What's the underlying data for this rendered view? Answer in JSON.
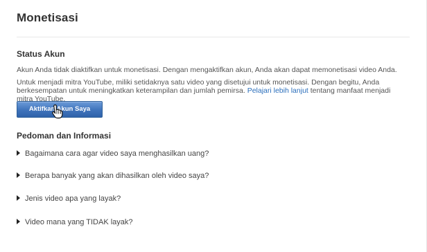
{
  "page": {
    "title": "Monetisasi"
  },
  "status": {
    "title": "Status Akun",
    "paragraph1": "Akun Anda tidak diaktifkan untuk monetisasi. Dengan mengaktifkan akun, Anda akan dapat memonetisasi video Anda.",
    "paragraph2_before": "Untuk menjadi mitra YouTube, miliki setidaknya satu video yang disetujui untuk monetisasi. Dengan begitu, Anda berkesempatan untuk meningkatkan keterampilan dan jumlah pemirsa. ",
    "paragraph2_link": "Pelajari lebih lanjut",
    "paragraph2_after": " tentang manfaat menjadi mitra YouTube.",
    "button_label": "Aktifkan Akun Saya"
  },
  "guide": {
    "title": "Pedoman dan Informasi",
    "items": [
      {
        "label": "Bagaimana cara agar video saya menghasilkan uang?"
      },
      {
        "label": "Berapa banyak yang akan dihasilkan oleh video saya?"
      },
      {
        "label": "Jenis video apa yang layak?"
      },
      {
        "label": "Video mana yang TIDAK layak?"
      }
    ]
  },
  "icons": {
    "faq_expand": "triangle-right-icon",
    "pointer": "hand-pointer-cursor-icon"
  },
  "colors": {
    "button": "#3f73bb",
    "link": "#2a6ebb"
  }
}
